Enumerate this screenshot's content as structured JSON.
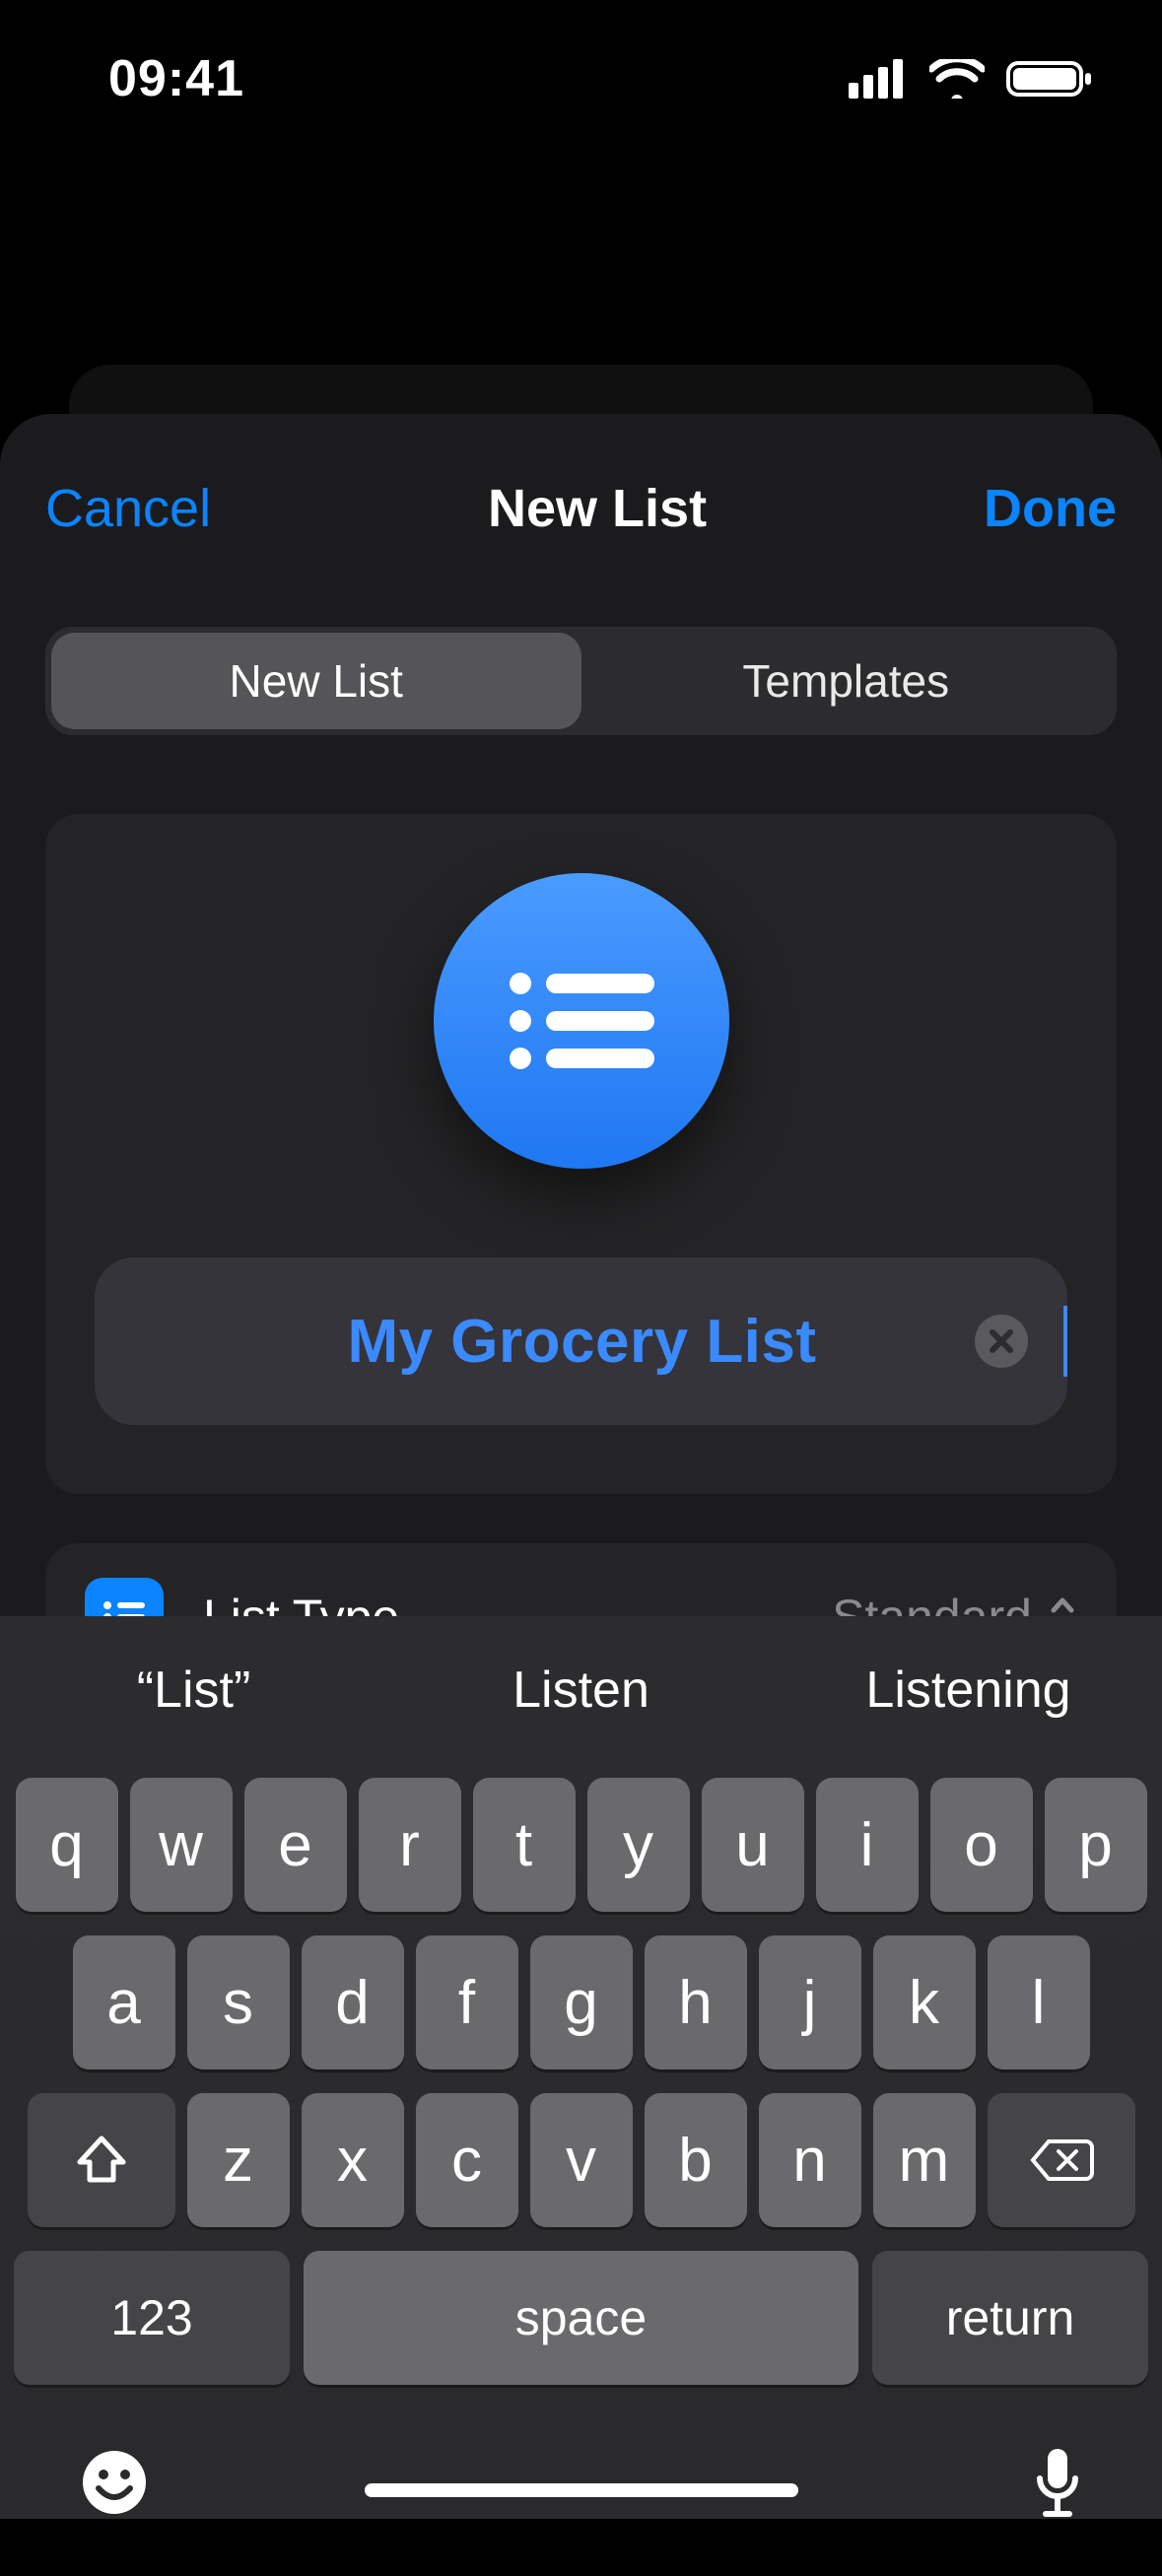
{
  "status": {
    "time": "09:41"
  },
  "sheet": {
    "cancel": "Cancel",
    "title": "New List",
    "done": "Done",
    "segments": [
      "New List",
      "Templates"
    ],
    "name_value": "My Grocery List",
    "list_type_label": "List Type",
    "list_type_value": "Standard",
    "colors": [
      {
        "name": "red",
        "hex": "#EB4D3D",
        "selected": false
      },
      {
        "name": "orange",
        "hex": "#F19A37",
        "selected": false
      },
      {
        "name": "yellow",
        "hex": "#F7CE45",
        "selected": false
      },
      {
        "name": "green",
        "hex": "#5DC466",
        "selected": false
      },
      {
        "name": "light-blue",
        "hex": "#70B7F6",
        "selected": false
      },
      {
        "name": "blue",
        "hex": "#1D7AFC",
        "selected": true
      }
    ]
  },
  "keyboard": {
    "suggestions": [
      "“List”",
      "Listen",
      "Listening"
    ],
    "row1": [
      "q",
      "w",
      "e",
      "r",
      "t",
      "y",
      "u",
      "i",
      "o",
      "p"
    ],
    "row2": [
      "a",
      "s",
      "d",
      "f",
      "g",
      "h",
      "j",
      "k",
      "l"
    ],
    "row3": [
      "z",
      "x",
      "c",
      "v",
      "b",
      "n",
      "m"
    ],
    "numbers_label": "123",
    "space_label": "space",
    "return_label": "return"
  }
}
